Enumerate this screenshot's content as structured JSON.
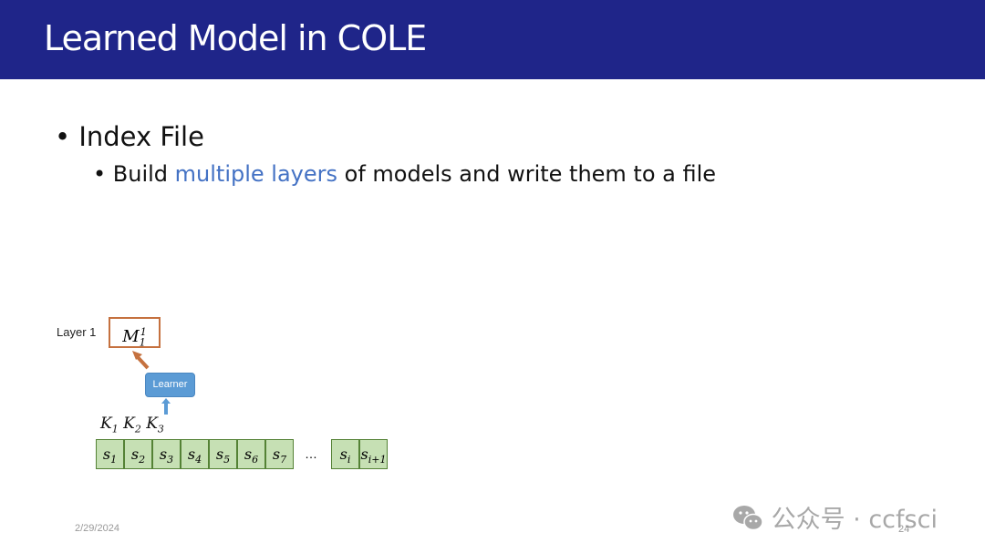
{
  "slide": {
    "title": "Learned Model in COLE",
    "bullet1": "Index File",
    "bullet2_pre": "Build ",
    "bullet2_hl": "multiple layers",
    "bullet2_post": " of models and write them to a file",
    "highlight_color": "#4472c4",
    "layer_label": "Layer 1",
    "model_label": "M",
    "model_sub": "1",
    "model_sup": "1",
    "learner_label": "Learner",
    "keys": [
      {
        "k": "K",
        "sub": "1"
      },
      {
        "k": "K",
        "sub": "2"
      },
      {
        "k": "K",
        "sub": "3"
      }
    ],
    "cells": [
      {
        "s": "s",
        "sub": "1"
      },
      {
        "s": "s",
        "sub": "2"
      },
      {
        "s": "s",
        "sub": "3"
      },
      {
        "s": "s",
        "sub": "4"
      },
      {
        "s": "s",
        "sub": "5"
      },
      {
        "s": "s",
        "sub": "6"
      },
      {
        "s": "s",
        "sub": "7"
      }
    ],
    "ellipsis": "…",
    "tail_cells": [
      {
        "s": "s",
        "sub": "i"
      },
      {
        "s": "s",
        "sub": "i+1"
      }
    ],
    "date": "2/29/2024",
    "page": "24"
  },
  "watermark": {
    "icon": "wechat-icon",
    "text": "公众号 · ccfsci"
  }
}
